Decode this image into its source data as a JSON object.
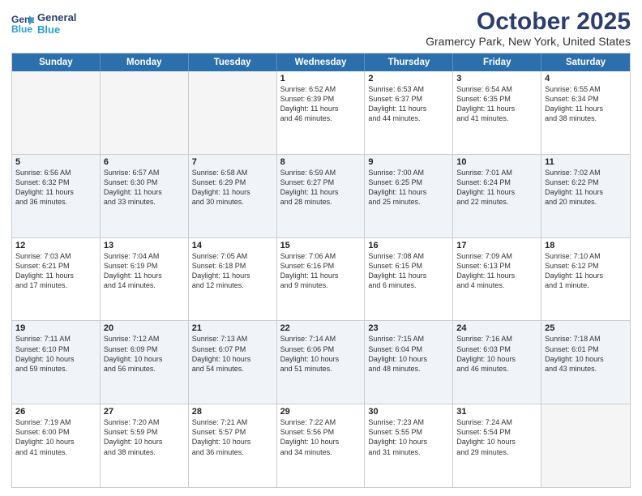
{
  "logo": {
    "line1": "General",
    "line2": "Blue"
  },
  "title": "October 2025",
  "subtitle": "Gramercy Park, New York, United States",
  "days": [
    "Sunday",
    "Monday",
    "Tuesday",
    "Wednesday",
    "Thursday",
    "Friday",
    "Saturday"
  ],
  "rows": [
    [
      {
        "num": "",
        "info": "",
        "empty": true
      },
      {
        "num": "",
        "info": "",
        "empty": true
      },
      {
        "num": "",
        "info": "",
        "empty": true
      },
      {
        "num": "1",
        "info": "Sunrise: 6:52 AM\nSunset: 6:39 PM\nDaylight: 11 hours\nand 46 minutes."
      },
      {
        "num": "2",
        "info": "Sunrise: 6:53 AM\nSunset: 6:37 PM\nDaylight: 11 hours\nand 44 minutes."
      },
      {
        "num": "3",
        "info": "Sunrise: 6:54 AM\nSunset: 6:35 PM\nDaylight: 11 hours\nand 41 minutes."
      },
      {
        "num": "4",
        "info": "Sunrise: 6:55 AM\nSunset: 6:34 PM\nDaylight: 11 hours\nand 38 minutes."
      }
    ],
    [
      {
        "num": "5",
        "info": "Sunrise: 6:56 AM\nSunset: 6:32 PM\nDaylight: 11 hours\nand 36 minutes."
      },
      {
        "num": "6",
        "info": "Sunrise: 6:57 AM\nSunset: 6:30 PM\nDaylight: 11 hours\nand 33 minutes."
      },
      {
        "num": "7",
        "info": "Sunrise: 6:58 AM\nSunset: 6:29 PM\nDaylight: 11 hours\nand 30 minutes."
      },
      {
        "num": "8",
        "info": "Sunrise: 6:59 AM\nSunset: 6:27 PM\nDaylight: 11 hours\nand 28 minutes."
      },
      {
        "num": "9",
        "info": "Sunrise: 7:00 AM\nSunset: 6:25 PM\nDaylight: 11 hours\nand 25 minutes."
      },
      {
        "num": "10",
        "info": "Sunrise: 7:01 AM\nSunset: 6:24 PM\nDaylight: 11 hours\nand 22 minutes."
      },
      {
        "num": "11",
        "info": "Sunrise: 7:02 AM\nSunset: 6:22 PM\nDaylight: 11 hours\nand 20 minutes."
      }
    ],
    [
      {
        "num": "12",
        "info": "Sunrise: 7:03 AM\nSunset: 6:21 PM\nDaylight: 11 hours\nand 17 minutes."
      },
      {
        "num": "13",
        "info": "Sunrise: 7:04 AM\nSunset: 6:19 PM\nDaylight: 11 hours\nand 14 minutes."
      },
      {
        "num": "14",
        "info": "Sunrise: 7:05 AM\nSunset: 6:18 PM\nDaylight: 11 hours\nand 12 minutes."
      },
      {
        "num": "15",
        "info": "Sunrise: 7:06 AM\nSunset: 6:16 PM\nDaylight: 11 hours\nand 9 minutes."
      },
      {
        "num": "16",
        "info": "Sunrise: 7:08 AM\nSunset: 6:15 PM\nDaylight: 11 hours\nand 6 minutes."
      },
      {
        "num": "17",
        "info": "Sunrise: 7:09 AM\nSunset: 6:13 PM\nDaylight: 11 hours\nand 4 minutes."
      },
      {
        "num": "18",
        "info": "Sunrise: 7:10 AM\nSunset: 6:12 PM\nDaylight: 11 hours\nand 1 minute."
      }
    ],
    [
      {
        "num": "19",
        "info": "Sunrise: 7:11 AM\nSunset: 6:10 PM\nDaylight: 10 hours\nand 59 minutes."
      },
      {
        "num": "20",
        "info": "Sunrise: 7:12 AM\nSunset: 6:09 PM\nDaylight: 10 hours\nand 56 minutes."
      },
      {
        "num": "21",
        "info": "Sunrise: 7:13 AM\nSunset: 6:07 PM\nDaylight: 10 hours\nand 54 minutes."
      },
      {
        "num": "22",
        "info": "Sunrise: 7:14 AM\nSunset: 6:06 PM\nDaylight: 10 hours\nand 51 minutes."
      },
      {
        "num": "23",
        "info": "Sunrise: 7:15 AM\nSunset: 6:04 PM\nDaylight: 10 hours\nand 48 minutes."
      },
      {
        "num": "24",
        "info": "Sunrise: 7:16 AM\nSunset: 6:03 PM\nDaylight: 10 hours\nand 46 minutes."
      },
      {
        "num": "25",
        "info": "Sunrise: 7:18 AM\nSunset: 6:01 PM\nDaylight: 10 hours\nand 43 minutes."
      }
    ],
    [
      {
        "num": "26",
        "info": "Sunrise: 7:19 AM\nSunset: 6:00 PM\nDaylight: 10 hours\nand 41 minutes."
      },
      {
        "num": "27",
        "info": "Sunrise: 7:20 AM\nSunset: 5:59 PM\nDaylight: 10 hours\nand 38 minutes."
      },
      {
        "num": "28",
        "info": "Sunrise: 7:21 AM\nSunset: 5:57 PM\nDaylight: 10 hours\nand 36 minutes."
      },
      {
        "num": "29",
        "info": "Sunrise: 7:22 AM\nSunset: 5:56 PM\nDaylight: 10 hours\nand 34 minutes."
      },
      {
        "num": "30",
        "info": "Sunrise: 7:23 AM\nSunset: 5:55 PM\nDaylight: 10 hours\nand 31 minutes."
      },
      {
        "num": "31",
        "info": "Sunrise: 7:24 AM\nSunset: 5:54 PM\nDaylight: 10 hours\nand 29 minutes."
      },
      {
        "num": "",
        "info": "",
        "empty": true
      }
    ]
  ]
}
